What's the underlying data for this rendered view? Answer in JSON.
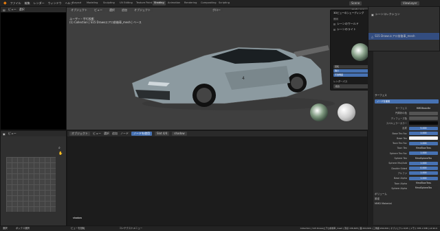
{
  "topbar": {
    "menus": [
      "ファイル",
      "編集",
      "レンダー",
      "ウィンドウ",
      "ヘルプ"
    ],
    "workspaces": [
      "Layout",
      "Modeling",
      "Sculpting",
      "UV Editing",
      "Texture Paint",
      "Shading",
      "Animation",
      "Rendering",
      "Compositing",
      "Scripting"
    ],
    "active_workspace": "Shading",
    "scene": "Scene",
    "view_layer": "ViewLayer"
  },
  "left_header": {
    "items": [
      "ビュー",
      "選択"
    ]
  },
  "left_bottom_header": {
    "items": [
      "ビュー"
    ]
  },
  "viewport": {
    "header_items": [
      "オブジェクト",
      "ビュー",
      "選択",
      "追加",
      "オブジェクト"
    ],
    "global": "グロー",
    "info_line1": "ユーザー・平行投影",
    "info_line2": "(1) Collection | S15 Drawsエアロ前後車_mesh | ベース",
    "options": "オプション"
  },
  "popover": {
    "title": "3Dビューのシェーディング",
    "light": "照明",
    "scene_world": "シーンのワールド",
    "scene_lights": "シーンのライト",
    "hdri_angle_label": "回転",
    "hdri_angle": "0°",
    "strength_label": "強さ",
    "strength": "1.000",
    "opacity_label": "不透明度",
    "opacity": "1.000",
    "render_pass": "レンダーパス",
    "render_pass_value": "統合"
  },
  "outliner": {
    "title": "シーンコレクション",
    "mesh": "S15 Drawsエアロ前後車_mesh",
    "shader": "shader"
  },
  "node_editor": {
    "header_items": [
      "オブジェクト",
      "ビュー",
      "選択",
      "追加",
      "ノード"
    ],
    "use_nodes": "ノードを使用",
    "slot": "Slot 4/4",
    "material": "shadow",
    "node_label": "shadow"
  },
  "properties": {
    "surface": "サーフェス",
    "node_material": "ノードを使用",
    "rows": [
      {
        "label": "サーフェス",
        "value": "MMDBasicBe",
        "style": "dark"
      },
      {
        "label": "円周状の色",
        "value": "",
        "style": "gray"
      },
      {
        "label": "ディフューズ色",
        "value": "",
        "style": "gray"
      },
      {
        "label": "スペキュラーカラー",
        "value": "",
        "style": "black"
      },
      {
        "label": "反射",
        "value": "5.000",
        "style": "blue"
      },
      {
        "label": "Base Tex Fac",
        "value": "1.000",
        "style": "blue"
      },
      {
        "label": "Base Tex",
        "value": "",
        "style": "white"
      },
      {
        "label": "Toon Tex Fac",
        "value": "1.000",
        "style": "blue"
      },
      {
        "label": "Toon Tex",
        "value": "MmdToonTexs",
        "style": "dark"
      },
      {
        "label": "Sphere Tex Fac",
        "value": "1.000",
        "style": "blue"
      },
      {
        "label": "Sphere Tex",
        "value": "MmdSphereTex",
        "style": "dark"
      },
      {
        "label": "Sphere Mul/Add",
        "value": "1.000",
        "style": "blue"
      },
      {
        "label": "Double Sided",
        "value": "0.000",
        "style": "blue"
      },
      {
        "label": "アルファ",
        "value": "1.000",
        "style": "blue"
      },
      {
        "label": "Base Alpha",
        "value": "1.000",
        "style": "blue"
      },
      {
        "label": "Toon Alpha",
        "value": "MmdToonTexs",
        "style": "dark"
      },
      {
        "label": "Sphere Alpha",
        "value": "MmdSphereTex",
        "style": "dark"
      }
    ],
    "volume": "ボリューム",
    "settings": "設定",
    "mmd_material": "MMD Material"
  },
  "status": {
    "left": "選択",
    "mid1": "ボックス選択",
    "mid2": "ビューを回転",
    "mid3": "コンテクストメニュー",
    "right": "Collection | S15 Drawsエアロ前後車_mesh | 頂点:136,605 | 面:204,826 | 三角面:204,826 | オブジェクト:0/45 | メモリ:335.1 MiB | v2.92.0"
  },
  "colors": {
    "accent": "#4772b3",
    "active_tab": "#3d3d3d",
    "bg": "#303030"
  }
}
